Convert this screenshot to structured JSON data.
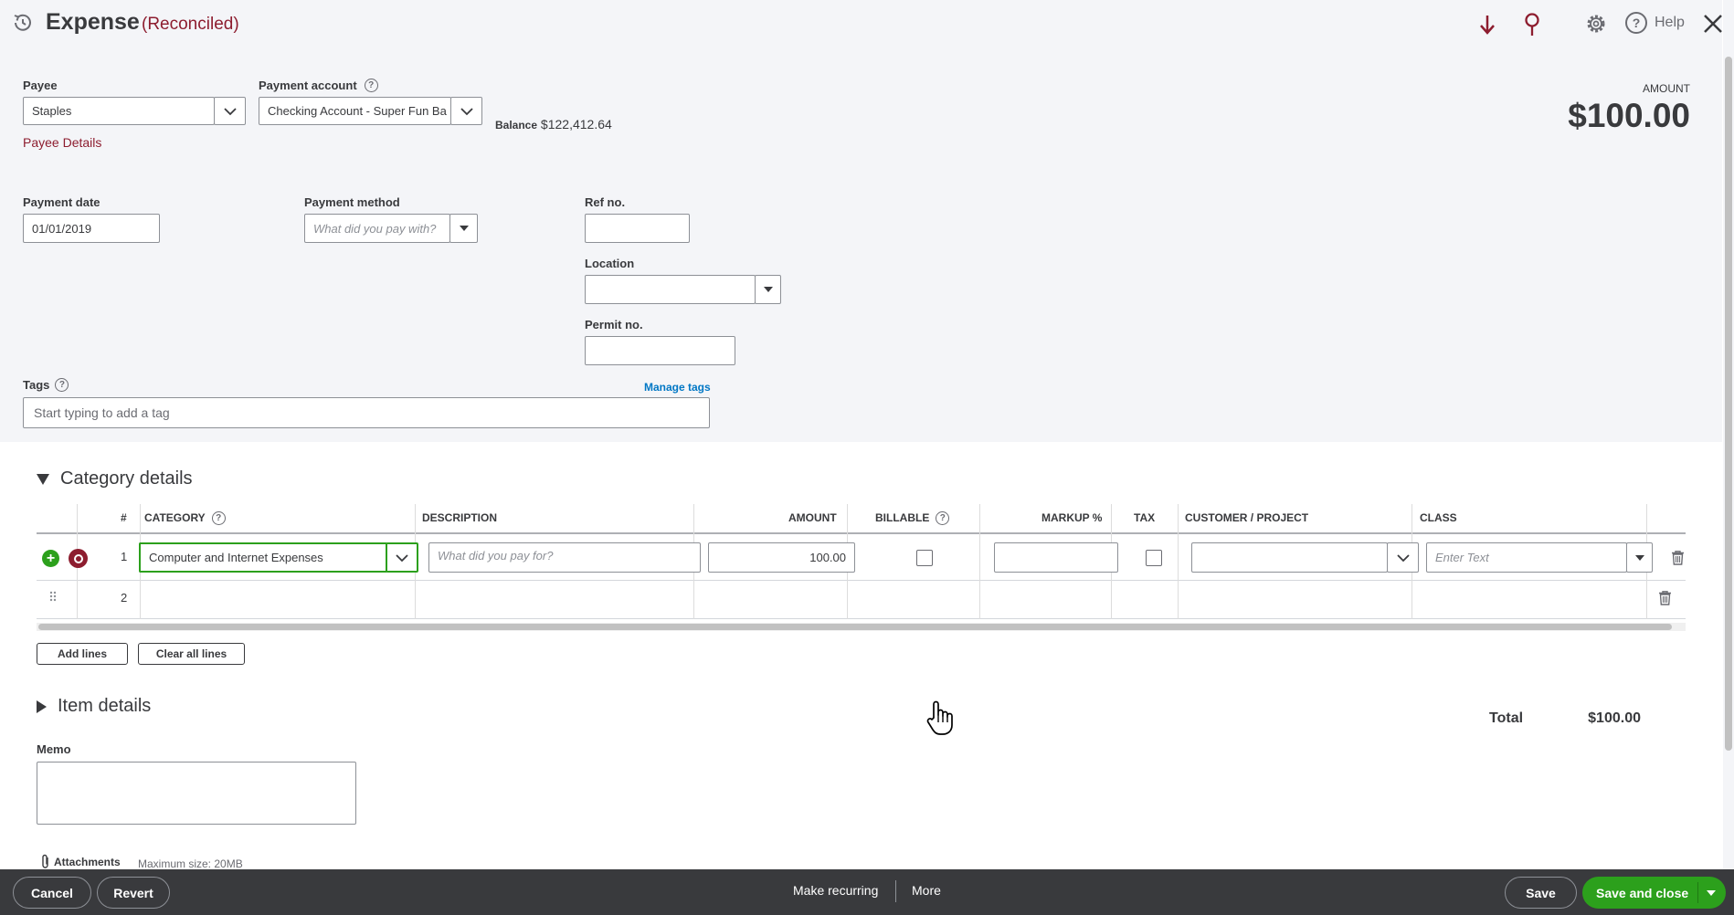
{
  "header": {
    "title": "Expense",
    "status": "(Reconciled)",
    "help_label": "Help"
  },
  "payee": {
    "label": "Payee",
    "value": "Staples",
    "details_link": "Payee Details"
  },
  "payment_account": {
    "label": "Payment account",
    "value": "Checking Account - Super Fun Ba",
    "balance_label": "Balance",
    "balance_value": "$122,412.64"
  },
  "amount_summary": {
    "label": "AMOUNT",
    "value": "$100.00"
  },
  "payment_date": {
    "label": "Payment date",
    "value": "01/01/2019"
  },
  "payment_method": {
    "label": "Payment method",
    "placeholder": "What did you pay with?"
  },
  "ref_no": {
    "label": "Ref no.",
    "value": ""
  },
  "location": {
    "label": "Location",
    "value": ""
  },
  "permit_no": {
    "label": "Permit no.",
    "value": ""
  },
  "tags": {
    "label": "Tags",
    "manage_link": "Manage tags",
    "placeholder": "Start typing to add a tag"
  },
  "category_details": {
    "title": "Category details",
    "columns": {
      "num": "#",
      "category": "CATEGORY",
      "description": "DESCRIPTION",
      "amount": "AMOUNT",
      "billable": "BILLABLE",
      "markup": "MARKUP %",
      "tax": "TAX",
      "customer": "CUSTOMER / PROJECT",
      "class": "CLASS"
    },
    "rows": [
      {
        "num": "1",
        "category": "Computer and Internet Expenses",
        "description_placeholder": "What did you pay for?",
        "amount": "100.00",
        "class_placeholder": "Enter Text"
      },
      {
        "num": "2"
      }
    ],
    "add_lines": "Add lines",
    "clear_lines": "Clear all lines"
  },
  "item_details": {
    "title": "Item details"
  },
  "total": {
    "label": "Total",
    "value": "$100.00"
  },
  "memo": {
    "label": "Memo",
    "value": ""
  },
  "attachments": {
    "label": "Attachments",
    "max_size": "Maximum size: 20MB"
  },
  "footer": {
    "cancel": "Cancel",
    "revert": "Revert",
    "make_recurring": "Make recurring",
    "more": "More",
    "save": "Save",
    "save_and_close": "Save and close"
  },
  "colors": {
    "brand_dark_red": "#8d1d2f",
    "accent_green": "#2ca01c",
    "link_blue": "#0077c5",
    "footer_bg": "#393a3d"
  }
}
